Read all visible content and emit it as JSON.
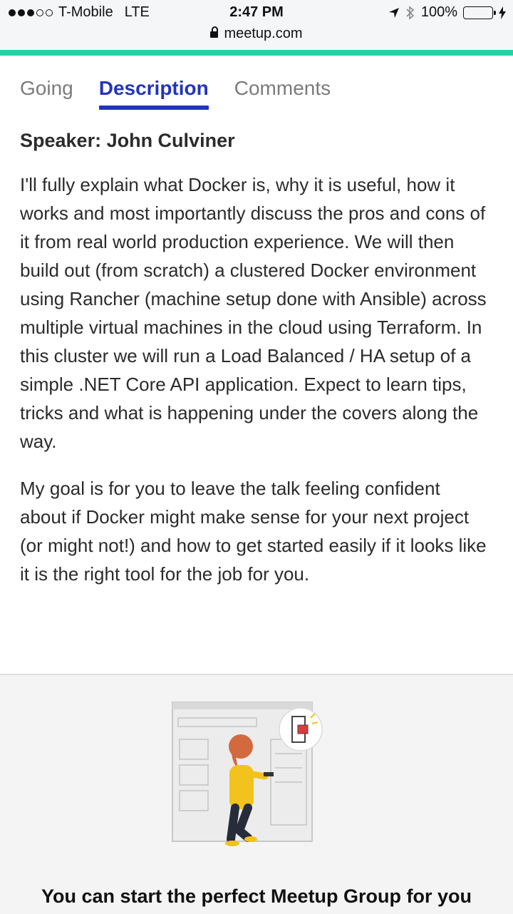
{
  "status_bar": {
    "carrier": "T-Mobile",
    "network": "LTE",
    "time": "2:47 PM",
    "battery": "100%",
    "battery_level": 1.0,
    "signal_bars": 3,
    "signal_total": 5,
    "url": "meetup.com"
  },
  "colors": {
    "accent": "#22d1a4",
    "tab_active": "#2434b8",
    "tab_inactive": "#7b7b7b"
  },
  "tabs": [
    {
      "label": "Going",
      "active": false
    },
    {
      "label": "Description",
      "active": true
    },
    {
      "label": "Comments",
      "active": false
    }
  ],
  "description": {
    "speaker": "Speaker: John Culviner",
    "paragraphs": [
      "I'll fully explain what Docker is, why it is useful, how it works and most importantly discuss the pros and cons of it from real world production experience. We will then build out (from scratch) a clustered Docker environment using Rancher (machine setup done with Ansible) across multiple virtual machines in the cloud using Terraform. In this cluster we will run a Load Balanced / HA setup of a simple .NET Core API application. Expect to learn tips, tricks and what is happening under the covers along the way.",
      "My goal is for you to leave the talk feeling confident about if Docker might make sense for your next project (or might not!) and how to get started easily if it looks like it is the right tool for the job for you."
    ]
  },
  "promo": {
    "heading": "You can start the perfect Meetup Group for you",
    "illustration_icon": "person-at-door-illustration"
  }
}
